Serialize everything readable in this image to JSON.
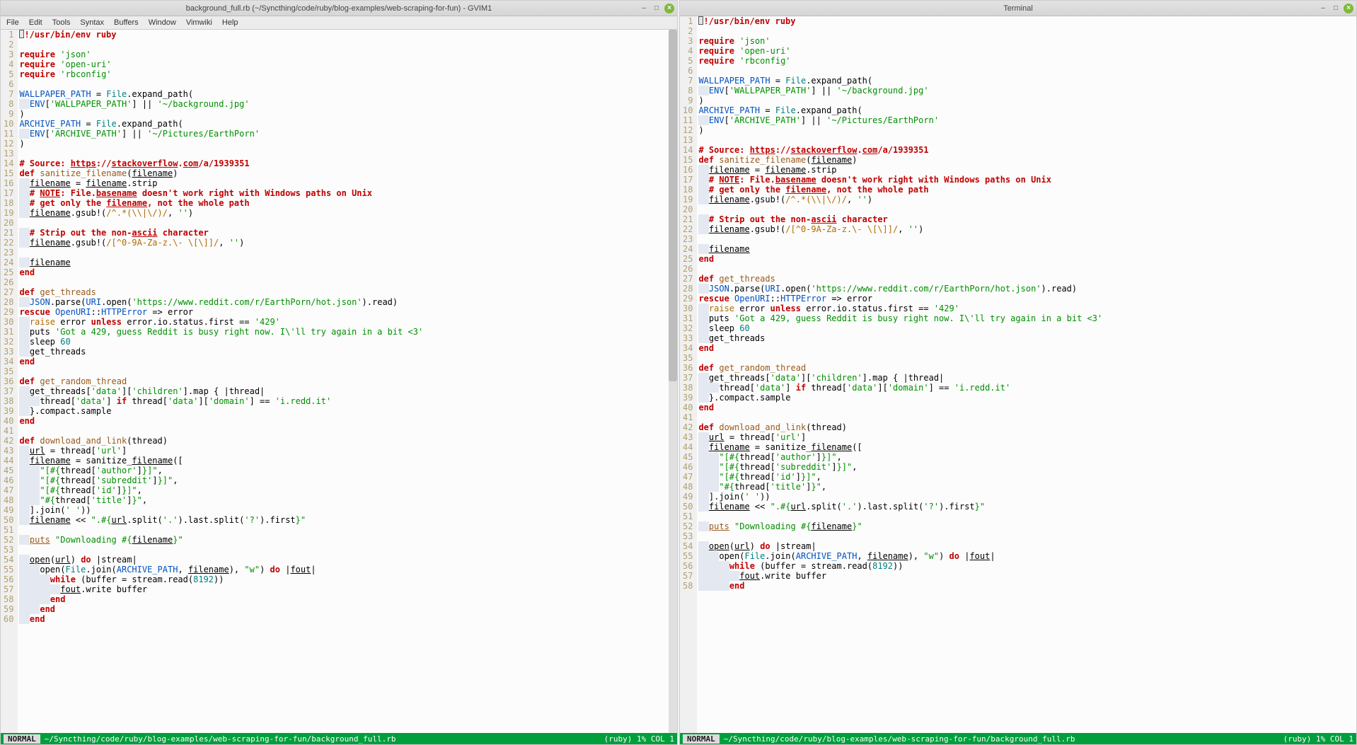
{
  "left": {
    "title": "background_full.rb (~/Syncthing/code/ruby/blog-examples/web-scraping-for-fun) - GVIM1",
    "menus": [
      "File",
      "Edit",
      "Tools",
      "Syntax",
      "Buffers",
      "Window",
      "Vimwiki",
      "Help"
    ],
    "status_mode": "NORMAL",
    "status_path": "~/Syncthing/code/ruby/blog-examples/web-scraping-for-fun/background_full.rb",
    "status_info": "(ruby) 1% COL 1",
    "line_start": 1,
    "line_end": 60
  },
  "right": {
    "title": "Terminal",
    "status_mode": "NORMAL",
    "status_path": "~/Syncthing/code/ruby/blog-examples/web-scraping-for-fun/background_full.rb",
    "status_info": "(ruby) 1% COL 1",
    "line_start": 1,
    "line_end": 58
  },
  "code": [
    [
      [
        "c-gray",
        ""
      ],
      [
        "c-red",
        "require"
      ],
      [
        "c-black",
        " "
      ],
      [
        "c-green",
        "'json'"
      ]
    ],
    [
      [
        "c-red",
        "require"
      ],
      [
        "c-black",
        " "
      ],
      [
        "c-green",
        "'open-uri'"
      ]
    ],
    [
      [
        "c-red",
        "require"
      ],
      [
        "c-black",
        " "
      ],
      [
        "c-green",
        "'rbconfig'"
      ]
    ],
    [],
    [
      [
        "c-blue",
        "WALLPAPER_PATH"
      ],
      [
        "c-black",
        " = "
      ],
      [
        "c-teal",
        "File"
      ],
      [
        "c-black",
        ".expand_path("
      ]
    ],
    [
      [
        "lead-sp",
        "  "
      ],
      [
        "c-blue",
        "ENV"
      ],
      [
        "c-black",
        "["
      ],
      [
        "c-green",
        "'WALLPAPER_PATH'"
      ],
      [
        "c-black",
        "] || "
      ],
      [
        "c-green",
        "'~/background.jpg'"
      ]
    ],
    [
      [
        "c-black",
        ")"
      ]
    ],
    [
      [
        "c-blue",
        "ARCHIVE_PATH"
      ],
      [
        "c-black",
        " = "
      ],
      [
        "c-teal",
        "File"
      ],
      [
        "c-black",
        ".expand_path("
      ]
    ],
    [
      [
        "lead-sp",
        "  "
      ],
      [
        "c-blue",
        "ENV"
      ],
      [
        "c-black",
        "["
      ],
      [
        "c-green",
        "'ARCHIVE_PATH'"
      ],
      [
        "c-black",
        "] || "
      ],
      [
        "c-green",
        "'~/Pictures/EarthPorn'"
      ]
    ],
    [
      [
        "c-black",
        ")"
      ]
    ],
    [],
    [
      [
        "c-red",
        "# Source: "
      ],
      [
        "c-red underline",
        "https"
      ],
      [
        "c-red",
        "://"
      ],
      [
        "c-red underline",
        "stackoverflow"
      ],
      [
        "c-red",
        "."
      ],
      [
        "c-red underline",
        "com"
      ],
      [
        "c-red",
        "/a/1939351"
      ]
    ],
    [
      [
        "c-red",
        "def"
      ],
      [
        "c-black",
        " "
      ],
      [
        "c-brown",
        "sanitize_filename"
      ],
      [
        "c-black",
        "("
      ],
      [
        "c-black underline",
        "filename"
      ],
      [
        "c-black",
        ")"
      ]
    ],
    [
      [
        "lead-sp",
        "  "
      ],
      [
        "c-black underline",
        "filename"
      ],
      [
        "c-black",
        " = "
      ],
      [
        "c-black underline",
        "filename"
      ],
      [
        "c-black",
        ".strip"
      ]
    ],
    [
      [
        "lead-sp",
        "  "
      ],
      [
        "c-red",
        "# "
      ],
      [
        "c-red underline",
        "NOTE"
      ],
      [
        "c-red",
        ": File."
      ],
      [
        "c-red underline",
        "basename"
      ],
      [
        "c-red",
        " doesn't work right with Windows paths on Unix"
      ]
    ],
    [
      [
        "lead-sp",
        "  "
      ],
      [
        "c-red",
        "# get only the "
      ],
      [
        "c-red underline",
        "filename"
      ],
      [
        "c-red",
        ", not the whole path"
      ]
    ],
    [
      [
        "lead-sp",
        "  "
      ],
      [
        "c-black underline",
        "filename"
      ],
      [
        "c-black",
        ".gsub!("
      ],
      [
        "c-orange",
        "/^.*(\\\\|\\/)/"
      ],
      [
        "c-black",
        ", "
      ],
      [
        "c-green",
        "''"
      ],
      [
        "c-black",
        ")"
      ]
    ],
    [],
    [
      [
        "lead-sp",
        "  "
      ],
      [
        "c-red",
        "# Strip out the non-"
      ],
      [
        "c-red underline",
        "ascii"
      ],
      [
        "c-red",
        " character"
      ]
    ],
    [
      [
        "lead-sp",
        "  "
      ],
      [
        "c-black underline",
        "filename"
      ],
      [
        "c-black",
        ".gsub!("
      ],
      [
        "c-orange",
        "/[^0-9A-Za-z.\\- \\[\\]]/"
      ],
      [
        "c-black",
        ", "
      ],
      [
        "c-green",
        "''"
      ],
      [
        "c-black",
        ")"
      ]
    ],
    [],
    [
      [
        "lead-sp",
        "  "
      ],
      [
        "c-black underline",
        "filename"
      ]
    ],
    [
      [
        "c-red",
        "end"
      ]
    ],
    [],
    [
      [
        "c-red",
        "def"
      ],
      [
        "c-black",
        " "
      ],
      [
        "c-brown",
        "get_threads"
      ]
    ],
    [
      [
        "lead-sp",
        "  "
      ],
      [
        "c-blue",
        "JSON"
      ],
      [
        "c-black",
        ".parse("
      ],
      [
        "c-blue",
        "URI"
      ],
      [
        "c-black",
        ".open("
      ],
      [
        "c-green",
        "'https://www.reddit.com/r/EarthPorn/hot.json'"
      ],
      [
        "c-black",
        ").read)"
      ]
    ],
    [
      [
        "c-red",
        "rescue"
      ],
      [
        "c-black",
        " "
      ],
      [
        "c-blue",
        "OpenURI"
      ],
      [
        "c-black",
        "::"
      ],
      [
        "c-blue",
        "HTTPError"
      ],
      [
        "c-black",
        " => error"
      ]
    ],
    [
      [
        "lead-sp",
        "  "
      ],
      [
        "c-orange",
        "raise"
      ],
      [
        "c-black",
        " error "
      ],
      [
        "c-red",
        "unless"
      ],
      [
        "c-black",
        " error.io.status.first == "
      ],
      [
        "c-green",
        "'429'"
      ]
    ],
    [
      [
        "lead-sp",
        "  "
      ],
      [
        "c-black",
        "puts "
      ],
      [
        "c-green",
        "'Got a 429, guess Reddit is busy right now. I\\'ll try again in a bit <3'"
      ]
    ],
    [
      [
        "lead-sp",
        "  "
      ],
      [
        "c-black",
        "sleep "
      ],
      [
        "c-teal",
        "60"
      ]
    ],
    [
      [
        "lead-sp",
        "  "
      ],
      [
        "c-black",
        "get_threads"
      ]
    ],
    [
      [
        "c-red",
        "end"
      ]
    ],
    [],
    [
      [
        "c-red",
        "def"
      ],
      [
        "c-black",
        " "
      ],
      [
        "c-brown",
        "get_random_thread"
      ]
    ],
    [
      [
        "lead-sp",
        "  "
      ],
      [
        "c-black",
        "get_threads["
      ],
      [
        "c-green",
        "'data'"
      ],
      [
        "c-black",
        "]["
      ],
      [
        "c-green",
        "'children'"
      ],
      [
        "c-black",
        "].map { |thread|"
      ]
    ],
    [
      [
        "lead-sp",
        "    "
      ],
      [
        "c-black",
        "thread["
      ],
      [
        "c-green",
        "'data'"
      ],
      [
        "c-black",
        "] "
      ],
      [
        "c-red",
        "if"
      ],
      [
        "c-black",
        " thread["
      ],
      [
        "c-green",
        "'data'"
      ],
      [
        "c-black",
        "]["
      ],
      [
        "c-green",
        "'domain'"
      ],
      [
        "c-black",
        "] == "
      ],
      [
        "c-green",
        "'i.redd.it'"
      ]
    ],
    [
      [
        "lead-sp",
        "  "
      ],
      [
        "c-black",
        "}.compact.sample"
      ]
    ],
    [
      [
        "c-red",
        "end"
      ]
    ],
    [],
    [
      [
        "c-red",
        "def"
      ],
      [
        "c-black",
        " "
      ],
      [
        "c-brown",
        "download_and_link"
      ],
      [
        "c-black",
        "(thread)"
      ]
    ],
    [
      [
        "lead-sp",
        "  "
      ],
      [
        "c-black underline",
        "url"
      ],
      [
        "c-black",
        " = thread["
      ],
      [
        "c-green",
        "'url'"
      ],
      [
        "c-black",
        "]"
      ]
    ],
    [
      [
        "lead-sp",
        "  "
      ],
      [
        "c-black underline",
        "filename"
      ],
      [
        "c-black",
        " = sanitize_"
      ],
      [
        "c-black underline",
        "filename"
      ],
      [
        "c-black",
        "(["
      ]
    ],
    [
      [
        "lead-sp",
        "    "
      ],
      [
        "c-green",
        "\"[#{"
      ],
      [
        "c-black",
        "thread["
      ],
      [
        "c-green",
        "'author'"
      ],
      [
        "c-black",
        "]"
      ],
      [
        "c-green",
        "}]\""
      ],
      [
        "c-black",
        ","
      ]
    ],
    [
      [
        "lead-sp",
        "    "
      ],
      [
        "c-green",
        "\"[#{"
      ],
      [
        "c-black",
        "thread["
      ],
      [
        "c-green",
        "'subreddit'"
      ],
      [
        "c-black",
        "]"
      ],
      [
        "c-green",
        "}]\""
      ],
      [
        "c-black",
        ","
      ]
    ],
    [
      [
        "lead-sp",
        "    "
      ],
      [
        "c-green",
        "\"[#{"
      ],
      [
        "c-black",
        "thread["
      ],
      [
        "c-green",
        "'id'"
      ],
      [
        "c-black",
        "]"
      ],
      [
        "c-green",
        "}]\""
      ],
      [
        "c-black",
        ","
      ]
    ],
    [
      [
        "lead-sp",
        "    "
      ],
      [
        "c-green",
        "\"#{"
      ],
      [
        "c-black",
        "thread["
      ],
      [
        "c-green",
        "'title'"
      ],
      [
        "c-black",
        "]"
      ],
      [
        "c-green",
        "}\""
      ],
      [
        "c-black",
        ","
      ]
    ],
    [
      [
        "lead-sp",
        "  "
      ],
      [
        "c-black",
        "].join("
      ],
      [
        "c-green",
        "' '"
      ],
      [
        "c-black",
        "))"
      ]
    ],
    [
      [
        "lead-sp",
        "  "
      ],
      [
        "c-black underline",
        "filename"
      ],
      [
        "c-black",
        " << "
      ],
      [
        "c-green",
        "\".#{"
      ],
      [
        "c-black underline",
        "url"
      ],
      [
        "c-black",
        ".split("
      ],
      [
        "c-green",
        "'.'"
      ],
      [
        "c-black",
        ").last.split("
      ],
      [
        "c-green",
        "'?'"
      ],
      [
        "c-black",
        ").first"
      ],
      [
        "c-green",
        "}\""
      ]
    ],
    [],
    [
      [
        "lead-sp",
        "  "
      ],
      [
        "c-brown underline",
        "puts"
      ],
      [
        "c-black",
        " "
      ],
      [
        "c-green",
        "\"Downloading #{"
      ],
      [
        "c-black underline",
        "filename"
      ],
      [
        "c-green",
        "}\""
      ]
    ],
    [],
    [
      [
        "lead-sp",
        "  "
      ],
      [
        "c-black underline",
        "open"
      ],
      [
        "c-black",
        "("
      ],
      [
        "c-black underline",
        "url"
      ],
      [
        "c-black",
        ") "
      ],
      [
        "c-red",
        "do"
      ],
      [
        "c-black",
        " |stream|"
      ]
    ],
    [
      [
        "lead-sp",
        "    "
      ],
      [
        "c-black",
        "open("
      ],
      [
        "c-teal",
        "File"
      ],
      [
        "c-black",
        ".join("
      ],
      [
        "c-blue",
        "ARCHIVE_PATH"
      ],
      [
        "c-black",
        ", "
      ],
      [
        "c-black underline",
        "filename"
      ],
      [
        "c-black",
        "), "
      ],
      [
        "c-green",
        "\"w\""
      ],
      [
        "c-black",
        ") "
      ],
      [
        "c-red",
        "do"
      ],
      [
        "c-black",
        " |"
      ],
      [
        "c-black underline",
        "fout"
      ],
      [
        "c-black",
        "|"
      ]
    ],
    [
      [
        "lead-sp",
        "      "
      ],
      [
        "c-red",
        "while"
      ],
      [
        "c-black",
        " (buffer = stream.read("
      ],
      [
        "c-teal",
        "8192"
      ],
      [
        "c-black",
        "))"
      ]
    ],
    [
      [
        "lead-sp",
        "        "
      ],
      [
        "c-black underline",
        "fout"
      ],
      [
        "c-black",
        ".write buffer"
      ]
    ],
    [
      [
        "lead-sp",
        "      "
      ],
      [
        "c-red",
        "end"
      ]
    ],
    [
      [
        "lead-sp",
        "    "
      ],
      [
        "c-red",
        "end"
      ]
    ],
    [
      [
        "lead-sp",
        "  "
      ],
      [
        "c-red",
        "end"
      ]
    ]
  ],
  "shebang": "#!/usr/bin/env ruby"
}
